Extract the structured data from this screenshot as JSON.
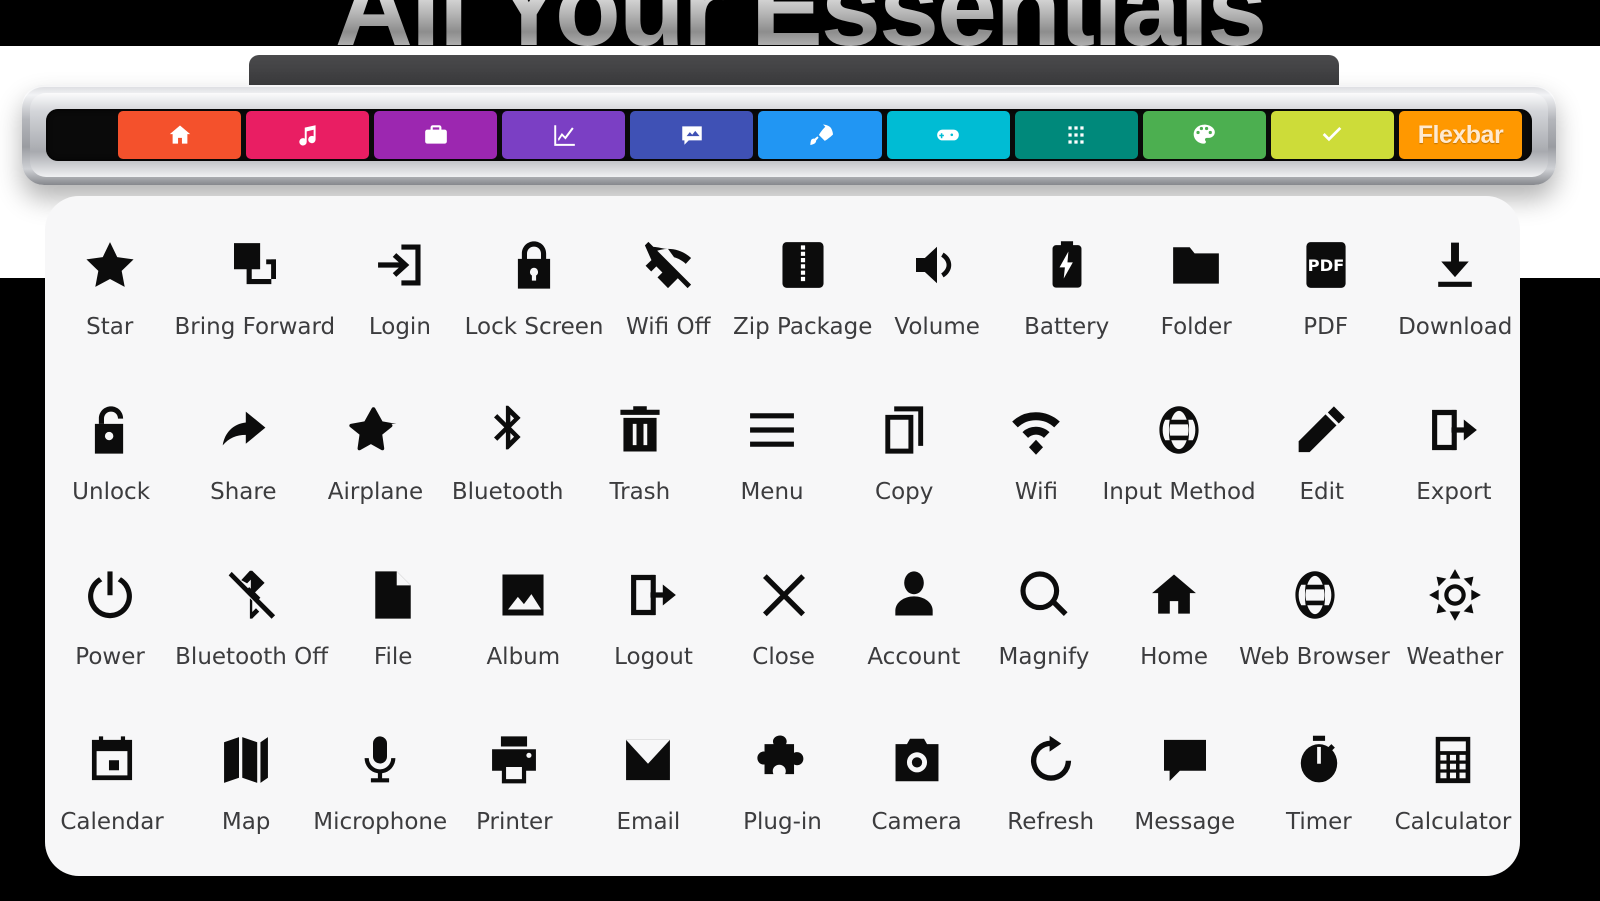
{
  "hero": {
    "title": "All Your Essentials"
  },
  "device": {
    "brand_tile_label": "Flexbar",
    "tiles": [
      {
        "name": "home",
        "icon": "home-icon",
        "color": "#F4512C",
        "label": ""
      },
      {
        "name": "music",
        "icon": "music-icon",
        "color": "#E91E63",
        "label": ""
      },
      {
        "name": "work",
        "icon": "briefcase-icon",
        "color": "#9C27B0",
        "label": ""
      },
      {
        "name": "stocks",
        "icon": "chart-icon",
        "color": "#7B3FC4",
        "label": ""
      },
      {
        "name": "media",
        "icon": "photo-chat-icon",
        "color": "#3F51B5",
        "label": ""
      },
      {
        "name": "launch",
        "icon": "rocket-icon",
        "color": "#2196F3",
        "label": ""
      },
      {
        "name": "game",
        "icon": "gamepad-icon",
        "color": "#00BCD4",
        "label": ""
      },
      {
        "name": "apps",
        "icon": "grid-icon",
        "color": "#00897B",
        "label": ""
      },
      {
        "name": "design",
        "icon": "palette-icon",
        "color": "#4CAF50",
        "label": ""
      },
      {
        "name": "tasks",
        "icon": "check-icon",
        "color": "#CDDC39",
        "label": ""
      },
      {
        "name": "flexbar",
        "icon": "text-label",
        "color": "#FF9800",
        "label": "Flexbar"
      }
    ]
  },
  "icon_grid": {
    "rows": [
      [
        {
          "label": "Star",
          "icon": "star-icon"
        },
        {
          "label": "Bring Forward",
          "icon": "bring-forward-icon"
        },
        {
          "label": "Login",
          "icon": "login-icon"
        },
        {
          "label": "Lock Screen",
          "icon": "lock-icon"
        },
        {
          "label": "Wifi Off",
          "icon": "wifi-off-icon"
        },
        {
          "label": "Zip Package",
          "icon": "zip-package-icon"
        },
        {
          "label": "Volume",
          "icon": "volume-icon"
        },
        {
          "label": "Battery",
          "icon": "battery-icon"
        },
        {
          "label": "Folder",
          "icon": "folder-icon"
        },
        {
          "label": "PDF",
          "icon": "pdf-icon"
        },
        {
          "label": "Download",
          "icon": "download-icon"
        }
      ],
      [
        {
          "label": "Unlock",
          "icon": "unlock-icon"
        },
        {
          "label": "Share",
          "icon": "share-icon"
        },
        {
          "label": "Airplane",
          "icon": "airplane-icon"
        },
        {
          "label": "Bluetooth",
          "icon": "bluetooth-icon"
        },
        {
          "label": "Trash",
          "icon": "trash-icon"
        },
        {
          "label": "Menu",
          "icon": "menu-icon"
        },
        {
          "label": "Copy",
          "icon": "copy-icon"
        },
        {
          "label": "Wifi",
          "icon": "wifi-icon"
        },
        {
          "label": "Input Method",
          "icon": "globe-icon"
        },
        {
          "label": "Edit",
          "icon": "pencil-icon"
        },
        {
          "label": "Export",
          "icon": "export-icon"
        }
      ],
      [
        {
          "label": "Power",
          "icon": "power-icon"
        },
        {
          "label": "Bluetooth Off",
          "icon": "bluetooth-off-icon"
        },
        {
          "label": "File",
          "icon": "file-icon"
        },
        {
          "label": "Album",
          "icon": "album-icon"
        },
        {
          "label": "Logout",
          "icon": "logout-icon"
        },
        {
          "label": "Close",
          "icon": "close-icon"
        },
        {
          "label": "Account",
          "icon": "account-icon"
        },
        {
          "label": "Magnify",
          "icon": "magnify-icon"
        },
        {
          "label": "Home",
          "icon": "home-icon"
        },
        {
          "label": "Web Browser",
          "icon": "globe-icon"
        },
        {
          "label": "Weather",
          "icon": "weather-icon"
        }
      ],
      [
        {
          "label": "Calendar",
          "icon": "calendar-icon"
        },
        {
          "label": "Map",
          "icon": "map-icon"
        },
        {
          "label": "Microphone",
          "icon": "microphone-icon"
        },
        {
          "label": "Printer",
          "icon": "printer-icon"
        },
        {
          "label": "Email",
          "icon": "email-icon"
        },
        {
          "label": "Plug-in",
          "icon": "puzzle-icon"
        },
        {
          "label": "Camera",
          "icon": "camera-icon"
        },
        {
          "label": "Refresh",
          "icon": "refresh-icon"
        },
        {
          "label": "Message",
          "icon": "message-icon"
        },
        {
          "label": "Timer",
          "icon": "timer-icon"
        },
        {
          "label": "Calculator",
          "icon": "calculator-icon"
        }
      ]
    ]
  }
}
